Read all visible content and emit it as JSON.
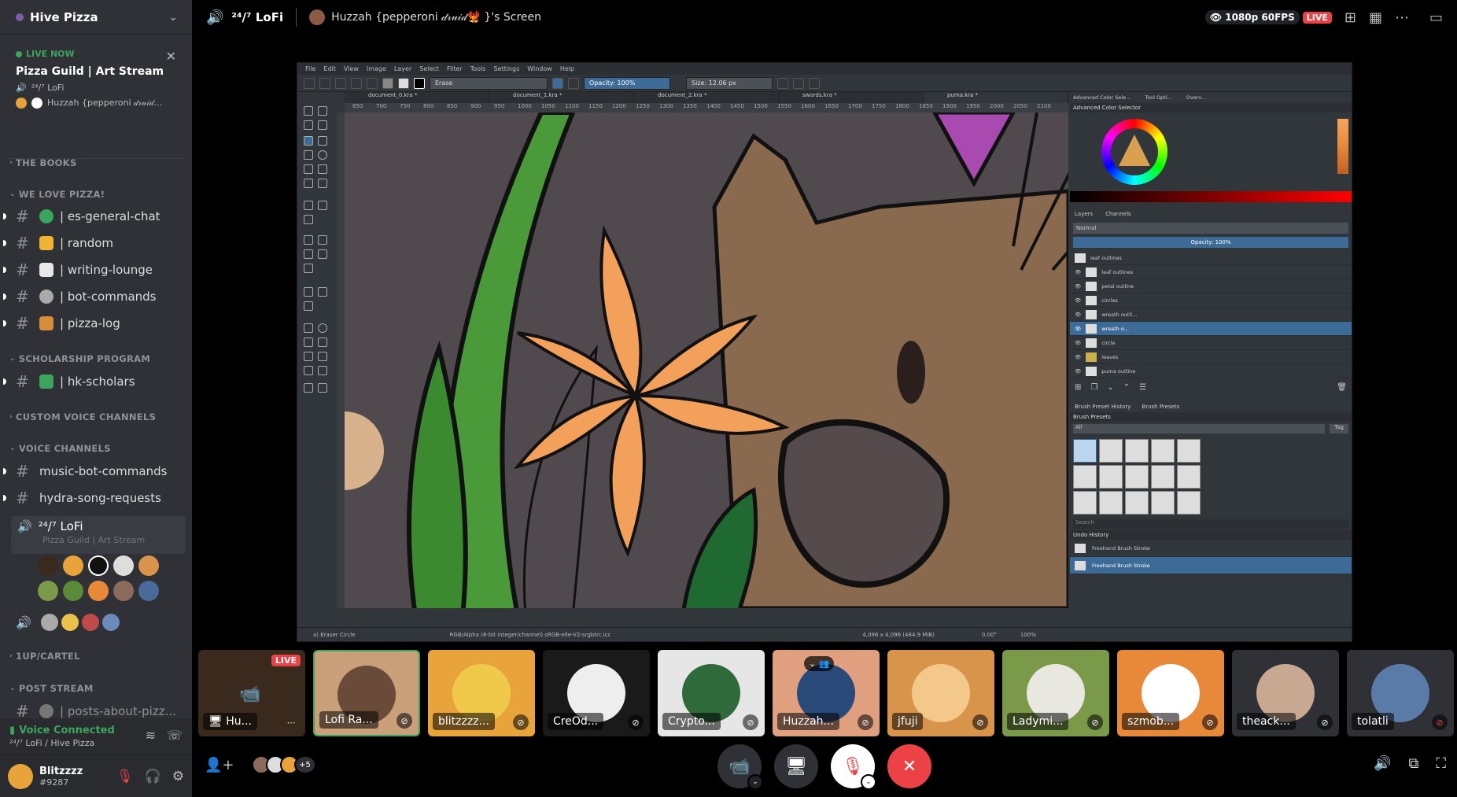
{
  "server": {
    "name": "Hive Pizza"
  },
  "live_card": {
    "live_label": "LIVE NOW",
    "title": "Pizza Guild | Art Stream",
    "channel": "²⁴/⁷ LoFi",
    "user": "Huzzah {pepperoni 𝒹𝓇𝓊𝒾𝒹..."
  },
  "categories": {
    "the_books": "THE BOOKS",
    "we_love_pizza": "WE LOVE PIZZA!",
    "scholarship": "SCHOLARSHIP PROGRAM",
    "custom_voice": "CUSTOM VOICE CHANNELS",
    "voice": "VOICE CHANNELS",
    "oneup": "1UP/CARTEL",
    "post_stream": "POST STREAM"
  },
  "channels": [
    {
      "name": "| es-general-chat"
    },
    {
      "name": "| random"
    },
    {
      "name": "| writing-lounge"
    },
    {
      "name": "| bot-commands"
    },
    {
      "name": "| pizza-log"
    },
    {
      "name": "| hk-scholars"
    },
    {
      "name": "music-bot-commands"
    },
    {
      "name": "hydra-song-requests"
    },
    {
      "name": "| posts-about-pizz..."
    }
  ],
  "voice_channel": {
    "name": "²⁴/⁷ LoFi",
    "sub": "Pizza Guild | Art Stream"
  },
  "voice_panel": {
    "status": "Voice Connected",
    "location": "²⁴/⁷ LoFi / Hive Pizza"
  },
  "user": {
    "name": "Blitzzzz",
    "tag": "#9287"
  },
  "topbar": {
    "channel": "²⁴/⁷ LoFi",
    "screen": "Huzzah {pepperoni 𝒹𝓇𝓊𝒾𝒹🐦‍🔥 }'s Screen",
    "quality": "1080p 60FPS",
    "live": "LIVE"
  },
  "krita": {
    "menu": [
      "File",
      "Edit",
      "View",
      "Image",
      "Layer",
      "Select",
      "Filter",
      "Tools",
      "Settings",
      "Window",
      "Help"
    ],
    "brush_mode": "Erase",
    "opacity": "Opacity: 100%",
    "size": "Size: 12.06 px",
    "tabs": [
      "document_0.kra *",
      "document_1.kra *",
      "document_2.kra *",
      "swords.kra *",
      "puma.kra *"
    ],
    "ruler": [
      "650",
      "700",
      "750",
      "800",
      "850",
      "900",
      "950",
      "1000",
      "1050",
      "1100",
      "1150",
      "1200",
      "1250",
      "1300",
      "1350",
      "1400",
      "1450",
      "1500",
      "1550",
      "1600",
      "1650",
      "1700",
      "1750",
      "1800",
      "1850",
      "1900",
      "1950",
      "2000",
      "2050",
      "2100"
    ],
    "dock_tabs": [
      "Advanced Color Sele...",
      "Tool Opti...",
      "Overv..."
    ],
    "color_selector": "Advanced Color Selector",
    "layer_tabs": [
      "Layers",
      "Channels"
    ],
    "blend": "Normal",
    "layer_opacity": "Opacity: 100%",
    "layers": [
      "leaf outlines",
      "leaf outlines",
      "petal outline",
      "circles",
      "wreath outli...",
      "wreath o...",
      "circle",
      "leaves",
      "puma outline"
    ],
    "brush_tabs": [
      "Brush Preset History",
      "Brush Presets"
    ],
    "brush_presets": "Brush Presets",
    "brush_filter": "All",
    "brush_tag": "Tag",
    "search": "Search",
    "undo_history": "Undo History",
    "history": [
      "Freehand Brush Stroke",
      "Freehand Brush Stroke"
    ],
    "status_tool": "a) Eraser Circle",
    "status_color": "RGB/Alpha (8-bit integer/channel)  sRGB-elle-V2-srgbtrc.icc",
    "status_size": "4,096 x 4,096 (484.9 MiB)",
    "status_angle": "0.00°",
    "status_zoom": "100%"
  },
  "participants": [
    {
      "name": "Hu...",
      "color": "#3a2a1e",
      "live": "LIVE"
    },
    {
      "name": "Lofi Ra...",
      "color": "#caa07a"
    },
    {
      "name": "blitzzzz...",
      "color": "#e8a43b"
    },
    {
      "name": "CreOd...",
      "color": "#1a1a1a"
    },
    {
      "name": "Crypto...",
      "color": "#e6e6e6"
    },
    {
      "name": "Huzzah...",
      "color": "#e0a080"
    },
    {
      "name": "jfuji",
      "color": "#d9944c"
    },
    {
      "name": "Ladymi...",
      "color": "#7a9a4a"
    },
    {
      "name": "szmob...",
      "color": "#e8893a"
    },
    {
      "name": "theack...",
      "color": "#2f3136"
    },
    {
      "name": "tolatli",
      "color": "#2f3136"
    }
  ],
  "controls": {
    "more_count": "+5"
  },
  "colors": {
    "accent_green": "#3ba55d",
    "danger_red": "#ed4245",
    "sidebar": "#2f3136"
  }
}
